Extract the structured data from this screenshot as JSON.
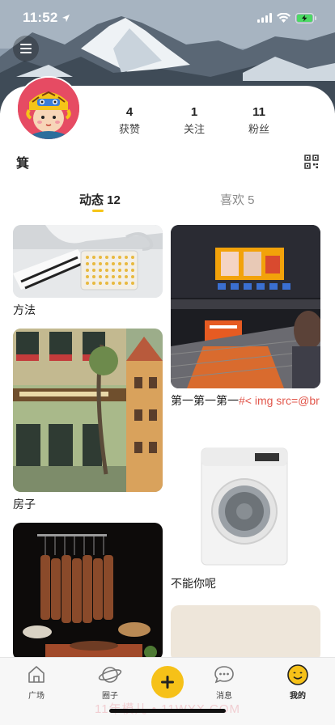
{
  "status_bar": {
    "time": "11:52"
  },
  "profile": {
    "username": "箕",
    "stats": [
      {
        "value": "4",
        "label": "获赞"
      },
      {
        "value": "1",
        "label": "关注"
      },
      {
        "value": "11",
        "label": "粉丝"
      }
    ]
  },
  "tabs": [
    {
      "label": "动态 12"
    },
    {
      "label": "喜欢 5"
    }
  ],
  "posts": [
    {
      "caption": "方法"
    },
    {
      "caption_plain": "第一第一第一",
      "caption_highlight": "#< img src=@br"
    },
    {
      "caption": "房子"
    },
    {
      "caption": "不能你呢"
    },
    {
      "caption": ""
    },
    {
      "caption": ""
    }
  ],
  "tabbar": {
    "items": [
      {
        "label": "广场",
        "icon": "home-icon"
      },
      {
        "label": "圈子",
        "icon": "planet-icon"
      },
      {
        "label": "",
        "icon": "plus-icon"
      },
      {
        "label": "消息",
        "icon": "chat-bubble-icon"
      },
      {
        "label": "我的",
        "icon": "smiley-icon"
      }
    ],
    "watermark": "11年模儿 • 11WYX.COM"
  },
  "colors": {
    "accent": "#f6c118",
    "highlight": "#e2574c"
  }
}
